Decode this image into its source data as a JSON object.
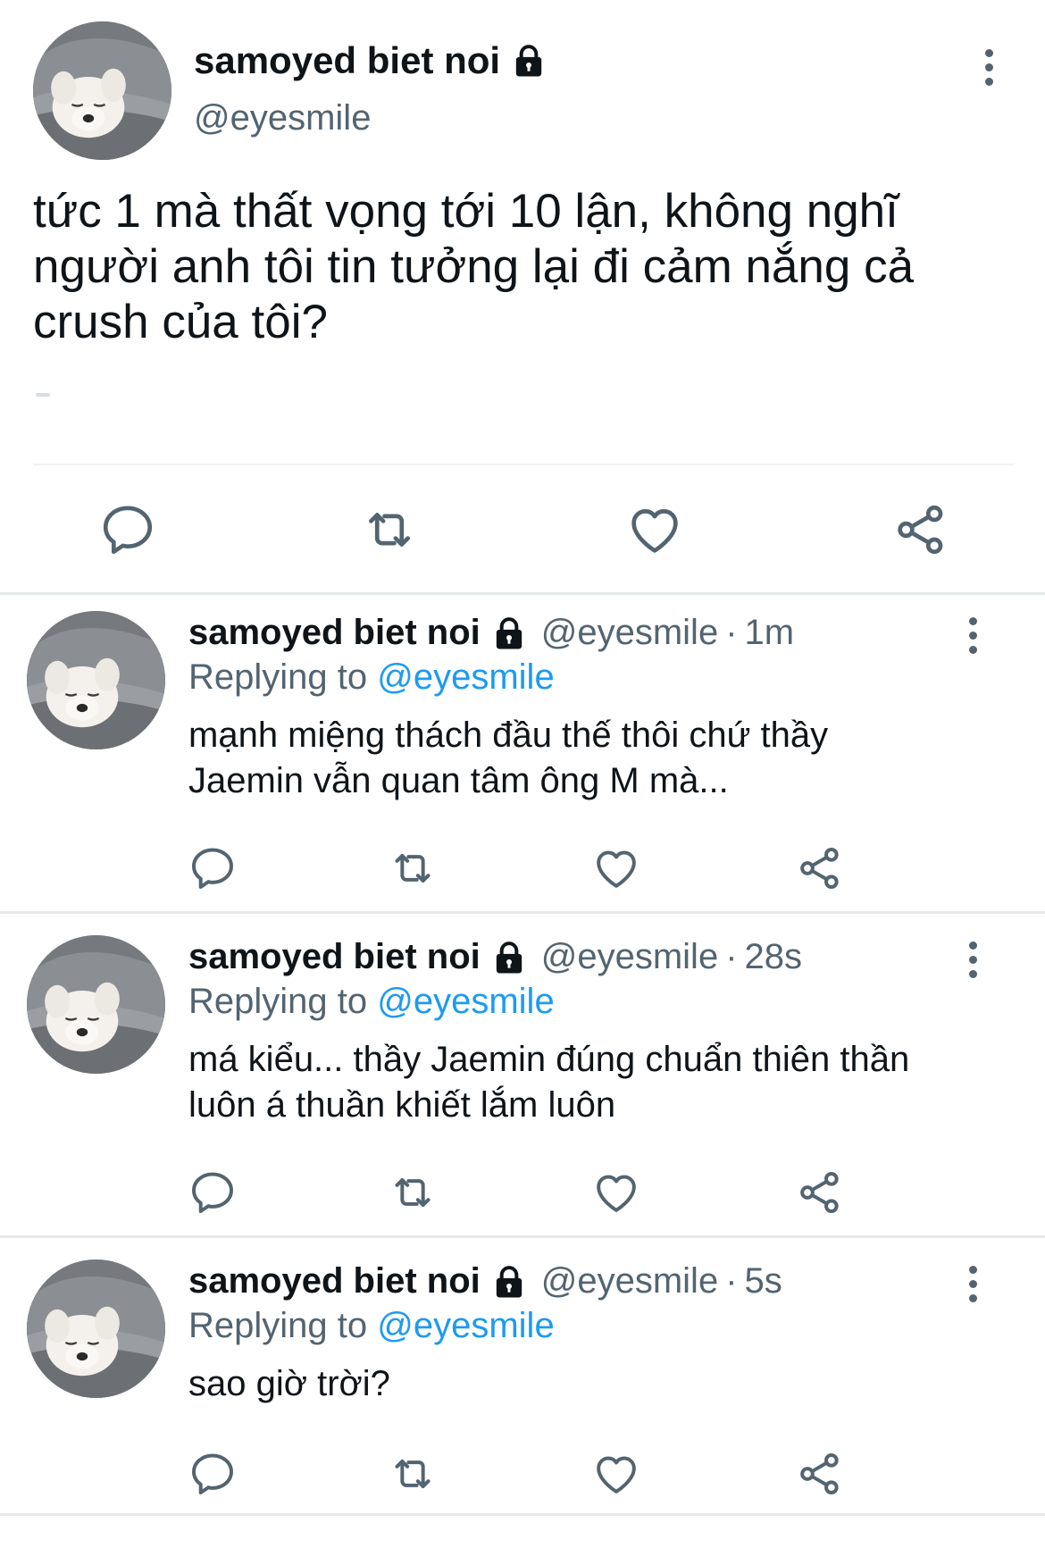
{
  "main_tweet": {
    "display_name": "samoyed biet noi",
    "handle": "@eyesmile",
    "text": "tức 1 mà thất vọng tới 10 lận, không nghĩ người anh tôi tin tưởng lại đi cảm nắng cả crush của tôi?"
  },
  "replies": [
    {
      "display_name": "samoyed biet noi",
      "handle": "@eyesmile",
      "separator": "·",
      "time": "1m",
      "replying_prefix": "Replying to",
      "replying_handle": "@eyesmile",
      "text": "mạnh miệng thách đầu thế thôi chứ thầy Jaemin vẫn quan tâm ông M mà..."
    },
    {
      "display_name": "samoyed biet noi",
      "handle": "@eyesmile",
      "separator": "·",
      "time": "28s",
      "replying_prefix": "Replying to",
      "replying_handle": "@eyesmile",
      "text": "má kiểu... thầy Jaemin đúng chuẩn thiên thần luôn á thuần khiết lắm luôn"
    },
    {
      "display_name": "samoyed biet noi",
      "handle": "@eyesmile",
      "separator": "·",
      "time": "5s",
      "replying_prefix": "Replying to",
      "replying_handle": "@eyesmile",
      "text": "sao giờ trời?"
    }
  ],
  "icons": {
    "reply": "reply-icon",
    "retweet": "retweet-icon",
    "like": "like-icon",
    "share": "share-icon",
    "more": "more-icon",
    "lock": "lock-icon"
  },
  "colors": {
    "text": "#0f1419",
    "secondary": "#536471",
    "link": "#1d9bf0",
    "divider": "#eff3f4"
  }
}
